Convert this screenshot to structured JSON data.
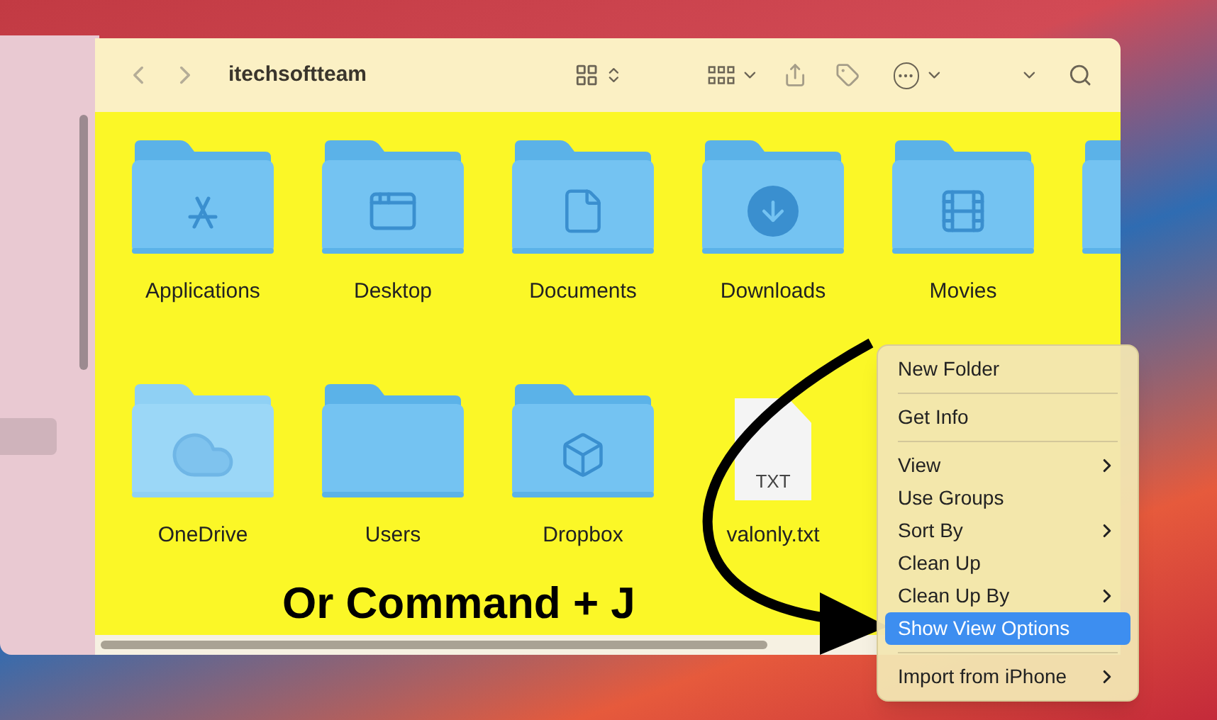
{
  "window": {
    "title": "itechsoftteam"
  },
  "items": [
    {
      "kind": "folder",
      "label": "Applications"
    },
    {
      "kind": "folder",
      "label": "Desktop"
    },
    {
      "kind": "folder",
      "label": "Documents"
    },
    {
      "kind": "folder",
      "label": "Downloads"
    },
    {
      "kind": "folder",
      "label": "Movies"
    },
    {
      "kind": "folder"
    },
    {
      "kind": "folder",
      "label": "OneDrive"
    },
    {
      "kind": "folder",
      "label": "Users"
    },
    {
      "kind": "folder",
      "label": "Dropbox"
    },
    {
      "kind": "document",
      "label": "valonly.txt",
      "badge": "TXT"
    }
  ],
  "annotation": "Or Command + J",
  "context_menu": [
    [
      {
        "label": "New Folder",
        "submenu": false,
        "selected": false
      }
    ],
    [
      {
        "label": "Get Info",
        "submenu": false,
        "selected": false
      }
    ],
    [
      {
        "label": "View",
        "submenu": true,
        "selected": false
      },
      {
        "label": "Use Groups",
        "submenu": false,
        "selected": false
      },
      {
        "label": "Sort By",
        "submenu": true,
        "selected": false
      },
      {
        "label": "Clean Up",
        "submenu": false,
        "selected": false
      },
      {
        "label": "Clean Up By",
        "submenu": true,
        "selected": false
      },
      {
        "label": "Show View Options",
        "submenu": false,
        "selected": true
      }
    ],
    [
      {
        "label": "Import from iPhone",
        "submenu": true,
        "selected": false
      }
    ]
  ]
}
